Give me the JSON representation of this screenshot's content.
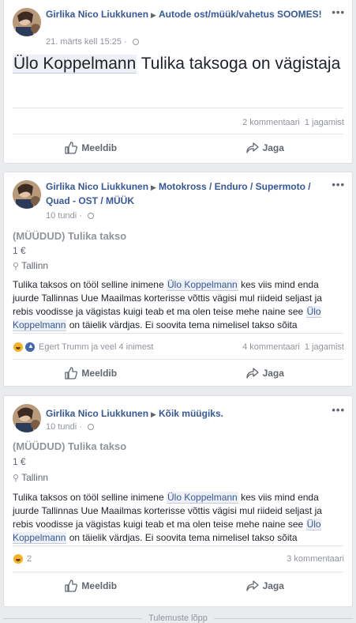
{
  "posts": [
    {
      "author": "Girlika Nico Liukkunen",
      "group": "Autode ost/müük/vahetus SOOMES!",
      "time": "21. märts kell 15:25",
      "text_mention": "Ülo Koppelmann",
      "text_rest": " Tulika taksoga on vägistaja",
      "comments": "2 kommentaari",
      "shares": "1 jagamist",
      "like_label": "Meeldib",
      "share_label": "Jaga"
    },
    {
      "author": "Girlika Nico Liukkunen",
      "group": "Motokross / Enduro / Supermoto / Quad - OST / MÜÜK",
      "time": "10 tundi",
      "item_title": "(MÜÜDUD) Tulika takso",
      "price": "1 €",
      "location": "Tallinn",
      "body_1": "Tulika taksos on tööl selline inimene ",
      "mention": "Ülo Koppelmann",
      "body_2": " kes viis mind enda juurde Tallinnas Uue Maailmas korterisse võttis vägisi mul riideid seljast ja rebis voodisse ja vägistas kuigi teab et ma olen teise mehe naine see ",
      "body_3": " on täielik värdjas. Ei soovita tema nimelisel takso sõita",
      "reactors": "Egert Trumm ja veel 4 inimest",
      "comments": "4 kommentaari",
      "shares": "1 jagamist",
      "like_label": "Meeldib",
      "share_label": "Jaga"
    },
    {
      "author": "Girlika Nico Liukkunen",
      "group": "Kõik müügiks.",
      "time": "10 tundi",
      "item_title": "(MÜÜDUD) Tulika takso",
      "price": "1 €",
      "location": "Tallinn",
      "body_1": "Tulika taksos on tööl selline inimene ",
      "mention": "Ülo Koppelmann",
      "body_2": " kes viis mind enda juurde Tallinnas Uue Maailmas korterisse võttis vägisi mul riideid seljast ja rebis voodisse ja vägistas kuigi teab et ma olen teise mehe naine see ",
      "body_3": " on täielik värdjas. Ei soovita tema nimelisel takso sõita",
      "reaction_count": "2",
      "comments": "3 kommentaari",
      "like_label": "Meeldib",
      "share_label": "Jaga"
    }
  ],
  "more_glyph": "•••",
  "end_label": "Tulemuste lõpp",
  "colors": {
    "link": "#365899",
    "background": "#e9ebee",
    "muted": "#90949c"
  }
}
